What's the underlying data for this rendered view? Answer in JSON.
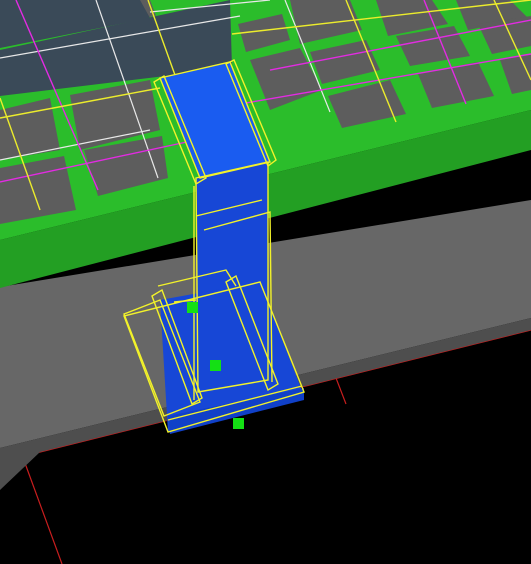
{
  "viewport": {
    "name": "3d-editor-viewport",
    "background_color": "#000000"
  },
  "colors": {
    "platform_top": "#2bbd2b",
    "platform_front": "#239f23",
    "tile_fill": "#5d5d5d",
    "slab_side": "#676767",
    "slab_dark": "#4e4e4e",
    "dark_panel": "#3a4a58",
    "part_fill": "#1747d6",
    "part_light": "#1a5cf0",
    "selection_outline": "#f2f22a",
    "handle": "#14e014",
    "grid_yellow": "#ecec2c",
    "grid_magenta": "#e32be3",
    "grid_white": "#e8e8e8",
    "axis_red": "#c81e1e"
  },
  "selection": {
    "object": "selected-blue-part",
    "handle_count": 3
  },
  "handles": [
    {
      "name": "transform-handle-top"
    },
    {
      "name": "transform-handle-middle"
    },
    {
      "name": "transform-handle-bottom"
    }
  ]
}
